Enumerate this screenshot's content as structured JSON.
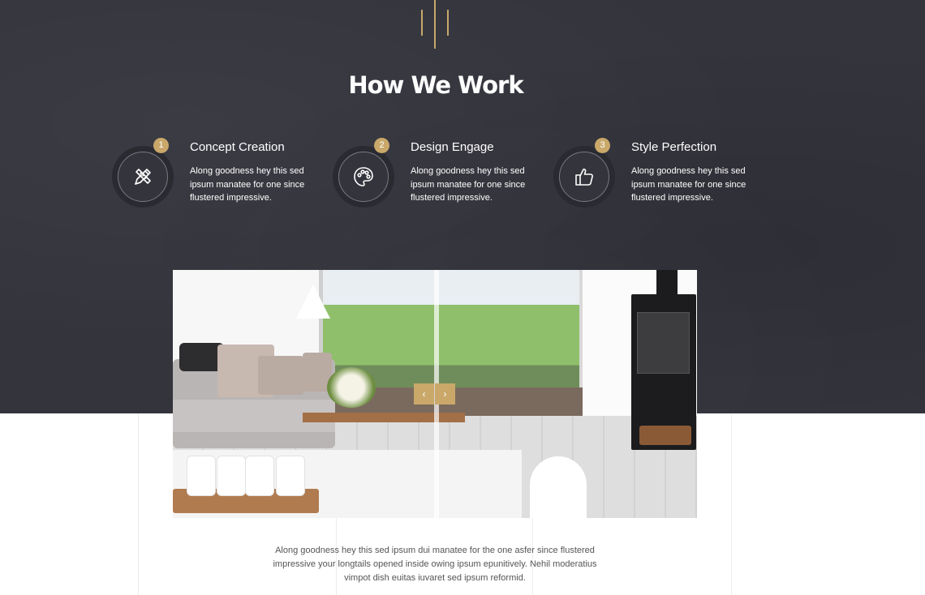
{
  "section": {
    "title": "How We Work"
  },
  "steps": [
    {
      "number": "1",
      "title": "Concept Creation",
      "description": "Along goodness hey this sed ipsum manatee for one since flustered impressive.",
      "icon": "pencil-ruler-icon"
    },
    {
      "number": "2",
      "title": "Design Engage",
      "description": "Along goodness hey this sed ipsum manatee for one since flustered impressive.",
      "icon": "palette-icon"
    },
    {
      "number": "3",
      "title": "Style Perfection",
      "description": "Along goodness hey this sed ipsum manatee for one since flustered impressive.",
      "icon": "thumbs-up-icon"
    }
  ],
  "slider": {
    "prev_icon": "chevron-left-icon",
    "next_icon": "chevron-right-icon",
    "prev_glyph": "‹",
    "next_glyph": "›"
  },
  "description": "Along goodness hey this sed ipsum dui manatee for the one asfer since flustered impressive your longtails opened inside owing ipsum epunitively. Nehil moderatius vimpot dish euitas iuvaret sed ipsum reformid.",
  "colors": {
    "dark_bg": "#34343d",
    "accent": "#c9a86a",
    "text_light": "#ffffff",
    "text_body": "#555555"
  }
}
